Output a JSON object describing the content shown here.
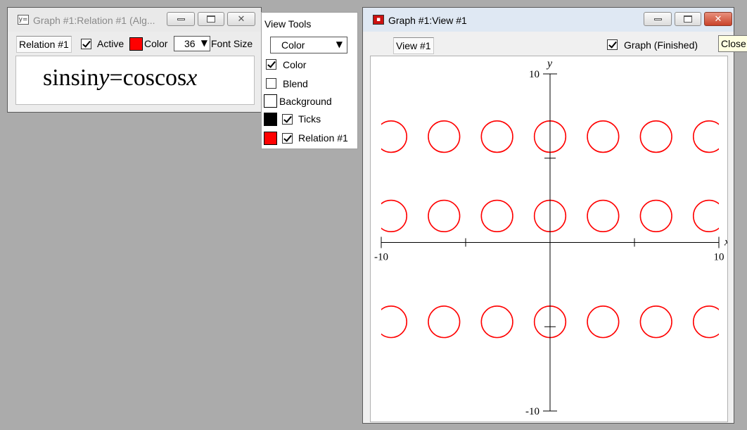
{
  "relation_window": {
    "title": "Graph #1:Relation #1 (Alg...",
    "app_icon": "y=",
    "name_tab": "Relation #1",
    "active_label": "Active",
    "active_checked": true,
    "color_label": "Color",
    "color": "#ff0000",
    "font_size_value": "36",
    "font_size_label": "Font Size",
    "formula": {
      "lhs_fn": "sinsin",
      "lhs_var": "y",
      "equals": "=",
      "rhs_fn": "coscos",
      "rhs_var": "x"
    }
  },
  "view_tools": {
    "title": "View Tools",
    "select_value": "Color",
    "color_label": "Color",
    "color_checked": true,
    "blend_label": "Blend",
    "blend_checked": false,
    "background_label": "Background",
    "background_color": "#ffffff",
    "ticks_label": "Ticks",
    "ticks_color": "#000000",
    "ticks_checked": true,
    "relation_label": "Relation #1",
    "relation_color": "#ff0000",
    "relation_checked": true
  },
  "view_window": {
    "title": "Graph #1:View #1",
    "view_tab": "View #1",
    "status_label": "Graph (Finished)",
    "status_checked": true,
    "tooltip": "Close",
    "x_axis_label": "x",
    "y_axis_label": "y",
    "x_min_label": "-10",
    "x_max_label": "10",
    "y_min_label": "-10",
    "y_max_label": "10",
    "curve_color": "#ff0000"
  },
  "chart_data": {
    "type": "scatter",
    "title": "",
    "xlabel": "x",
    "ylabel": "y",
    "xlim": [
      -10,
      10
    ],
    "ylim": [
      -10,
      10
    ],
    "x_ticks": [
      -10,
      -5,
      0,
      5,
      10
    ],
    "y_ticks": [
      -10,
      -5,
      0,
      5,
      10
    ],
    "tick_labels": [
      "-10",
      "10",
      "-10",
      "10"
    ],
    "series": [
      {
        "description_free": true,
        "circle_centers_x": [
          -9.42,
          -6.28,
          -3.14,
          0,
          3.14,
          6.28,
          9.42
        ],
        "circle_centers_y": [
          6.28,
          1.57,
          -4.71
        ],
        "circle_radius": 0.93
      }
    ]
  }
}
